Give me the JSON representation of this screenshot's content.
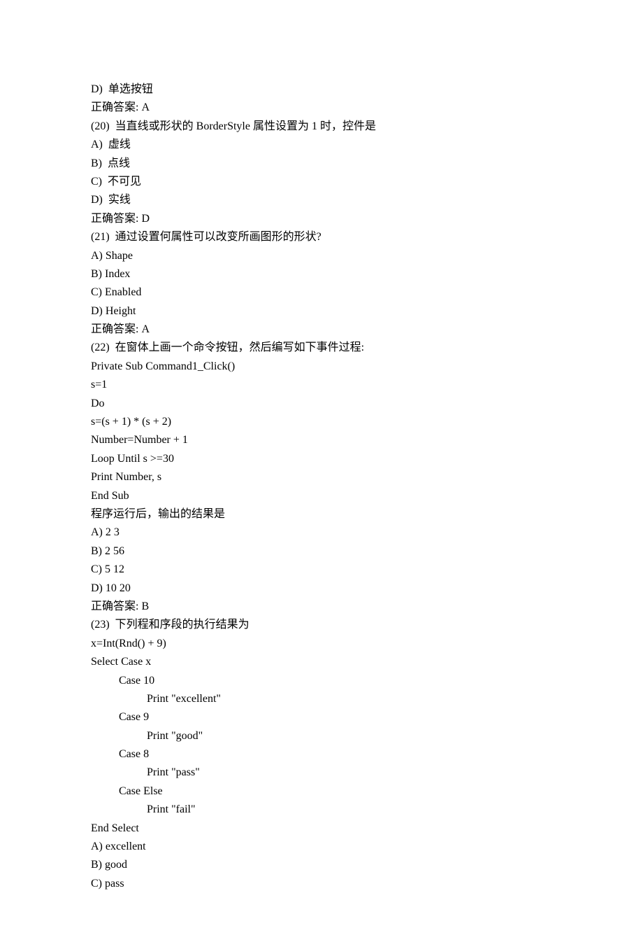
{
  "lines": [
    {
      "text": "D)  单选按钮",
      "indent": 0
    },
    {
      "text": "正确答案: A",
      "indent": 0
    },
    {
      "text": "(20)  当直线或形状的 BorderStyle 属性设置为 1 时，控件是",
      "indent": 0
    },
    {
      "text": "A)  虚线",
      "indent": 0
    },
    {
      "text": "B)  点线",
      "indent": 0
    },
    {
      "text": "C)  不可见",
      "indent": 0
    },
    {
      "text": "D)  实线",
      "indent": 0
    },
    {
      "text": "正确答案: D",
      "indent": 0
    },
    {
      "text": "(21)  通过设置何属性可以改变所画图形的形状?",
      "indent": 0
    },
    {
      "text": "A) Shape",
      "indent": 0
    },
    {
      "text": "B) Index",
      "indent": 0
    },
    {
      "text": "C) Enabled",
      "indent": 0
    },
    {
      "text": "D) Height",
      "indent": 0
    },
    {
      "text": "正确答案: A",
      "indent": 0
    },
    {
      "text": "(22)  在窗体上画一个命令按钮，然后编写如下事件过程:",
      "indent": 0
    },
    {
      "text": "Private Sub Command1_Click()",
      "indent": 0
    },
    {
      "text": "s=1",
      "indent": 0
    },
    {
      "text": "Do",
      "indent": 0
    },
    {
      "text": "s=(s + 1) * (s + 2)",
      "indent": 0
    },
    {
      "text": "Number=Number + 1",
      "indent": 0
    },
    {
      "text": "Loop Until s >=30",
      "indent": 0
    },
    {
      "text": "Print Number, s",
      "indent": 0
    },
    {
      "text": "End Sub",
      "indent": 0
    },
    {
      "text": "程序运行后，输出的结果是",
      "indent": 0
    },
    {
      "text": "A) 2 3",
      "indent": 0
    },
    {
      "text": "B) 2 56",
      "indent": 0
    },
    {
      "text": "C) 5 12",
      "indent": 0
    },
    {
      "text": "D) 10 20",
      "indent": 0
    },
    {
      "text": "正确答案: B",
      "indent": 0
    },
    {
      "text": "(23)  下列程和序段的执行结果为",
      "indent": 0
    },
    {
      "text": "x=Int(Rnd() + 9)",
      "indent": 0
    },
    {
      "text": "Select Case x",
      "indent": 0
    },
    {
      "text": "Case 10",
      "indent": 1
    },
    {
      "text": "Print \"excellent\"",
      "indent": 2
    },
    {
      "text": "Case 9",
      "indent": 1
    },
    {
      "text": "Print \"good\"",
      "indent": 2
    },
    {
      "text": "Case 8",
      "indent": 1
    },
    {
      "text": "Print \"pass\"",
      "indent": 2
    },
    {
      "text": "Case Else",
      "indent": 1
    },
    {
      "text": "Print \"fail\"",
      "indent": 2
    },
    {
      "text": "End Select",
      "indent": 0
    },
    {
      "text": "A) excellent",
      "indent": 0
    },
    {
      "text": "B) good",
      "indent": 0
    },
    {
      "text": "C) pass",
      "indent": 0
    }
  ]
}
